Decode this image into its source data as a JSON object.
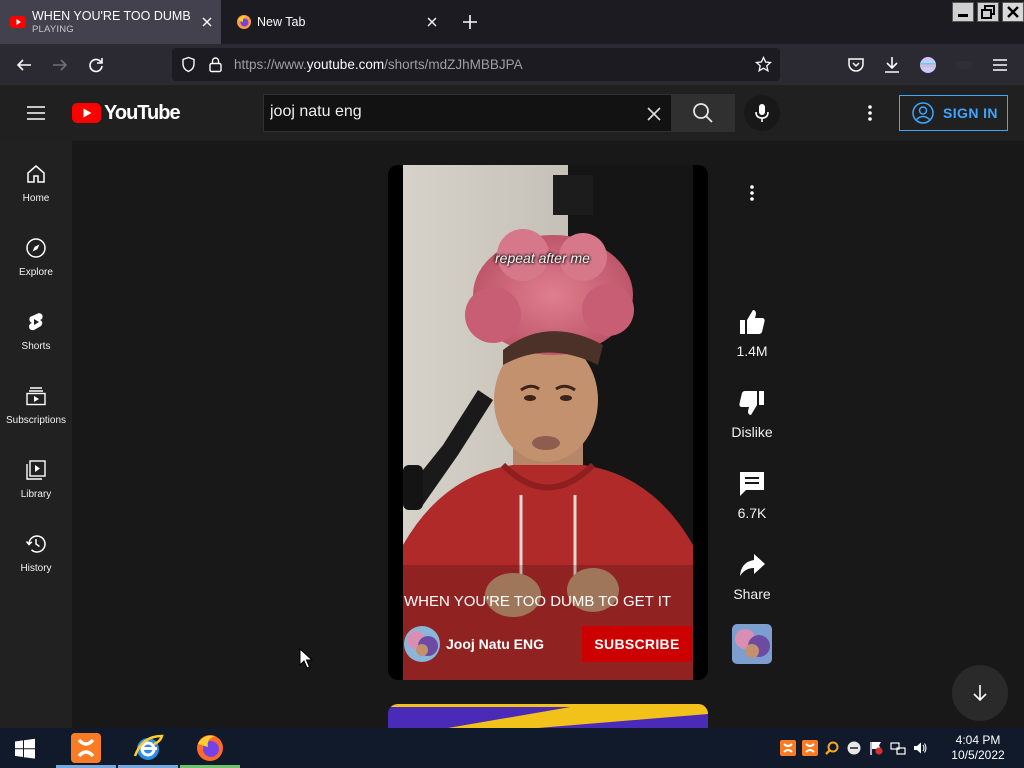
{
  "browser": {
    "tabs": [
      {
        "title": "WHEN YOU'RE TOO DUMB TO GET IT",
        "status": "PLAYING",
        "active": true
      },
      {
        "title": "New Tab",
        "active": false
      }
    ],
    "url": {
      "prefix": "https://www.",
      "domain": "youtube.com",
      "path": "/shorts/mdZJhMBBJPA"
    }
  },
  "youtube": {
    "logo_text": "YouTube",
    "search": {
      "value": "jooj natu eng",
      "placeholder": "Search"
    },
    "signin_label": "SIGN IN",
    "sidebar": [
      {
        "label": "Home",
        "icon": "home-icon"
      },
      {
        "label": "Explore",
        "icon": "compass-icon"
      },
      {
        "label": "Shorts",
        "icon": "shorts-icon"
      },
      {
        "label": "Subscriptions",
        "icon": "subscriptions-icon"
      },
      {
        "label": "Library",
        "icon": "library-icon"
      },
      {
        "label": "History",
        "icon": "history-icon"
      }
    ],
    "short": {
      "caption": "repeat after me",
      "title": "WHEN YOU'RE TOO DUMB TO GET IT",
      "channel": "Jooj Natu ENG",
      "subscribe_label": "SUBSCRIBE",
      "likes": "1.4M",
      "dislike_label": "Dislike",
      "comments": "6.7K",
      "share_label": "Share"
    }
  },
  "taskbar": {
    "time": "4:04 PM",
    "date": "10/5/2022",
    "apps": [
      "xampp",
      "internet-explorer",
      "firefox"
    ]
  },
  "colors": {
    "yt_red": "#ff0000",
    "subscribe_red": "#cc0000",
    "signin_blue": "#3ea6ff",
    "hoodie_red": "#b02a2a",
    "hair_pink": "#d96a80"
  }
}
